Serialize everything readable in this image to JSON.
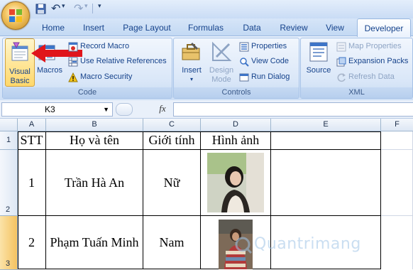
{
  "quick_access": {
    "undo_label": "↶",
    "redo_label": "↷",
    "more_label": "▾"
  },
  "tabs": [
    {
      "label": "Home"
    },
    {
      "label": "Insert"
    },
    {
      "label": "Page Layout"
    },
    {
      "label": "Formulas"
    },
    {
      "label": "Data"
    },
    {
      "label": "Review"
    },
    {
      "label": "View"
    },
    {
      "label": "Developer"
    }
  ],
  "active_tab": "Developer",
  "ribbon": {
    "code": {
      "visual_basic": "Visual Basic",
      "visual_basic_l1": "Visual",
      "visual_basic_l2": "Basic",
      "macros": "Macros",
      "record_macro": "Record Macro",
      "use_relative": "Use Relative References",
      "macro_security": "Macro Security",
      "group_label": "Code"
    },
    "controls": {
      "insert": "Insert",
      "design_mode_l1": "Design",
      "design_mode_l2": "Mode",
      "properties": "Properties",
      "view_code": "View Code",
      "run_dialog": "Run Dialog",
      "group_label": "Controls"
    },
    "xml": {
      "source": "Source",
      "map_properties": "Map Properties",
      "expansion_packs": "Expansion Packs",
      "refresh_data": "Refresh Data",
      "group_label": "XML"
    }
  },
  "formula_bar": {
    "name_box": "K3",
    "fx_label": "fx",
    "formula": ""
  },
  "columns": [
    "A",
    "B",
    "C",
    "D",
    "E",
    "F"
  ],
  "rows": [
    "1",
    "2",
    "3"
  ],
  "sheet": {
    "header": {
      "stt": "STT",
      "name": "Họ và tên",
      "gender": "Giới tính",
      "image": "Hình ảnh"
    },
    "row2": {
      "stt": "1",
      "name": "Trần Hà An",
      "gender": "Nữ"
    },
    "row3": {
      "stt": "2",
      "name": "Phạm Tuấn Minh",
      "gender": "Nam"
    }
  },
  "watermark": "Quantrimang",
  "colors": {
    "annotation_arrow": "#e0151b",
    "ribbon_text": "#15428b",
    "active_row_header": "#f9d88f"
  }
}
